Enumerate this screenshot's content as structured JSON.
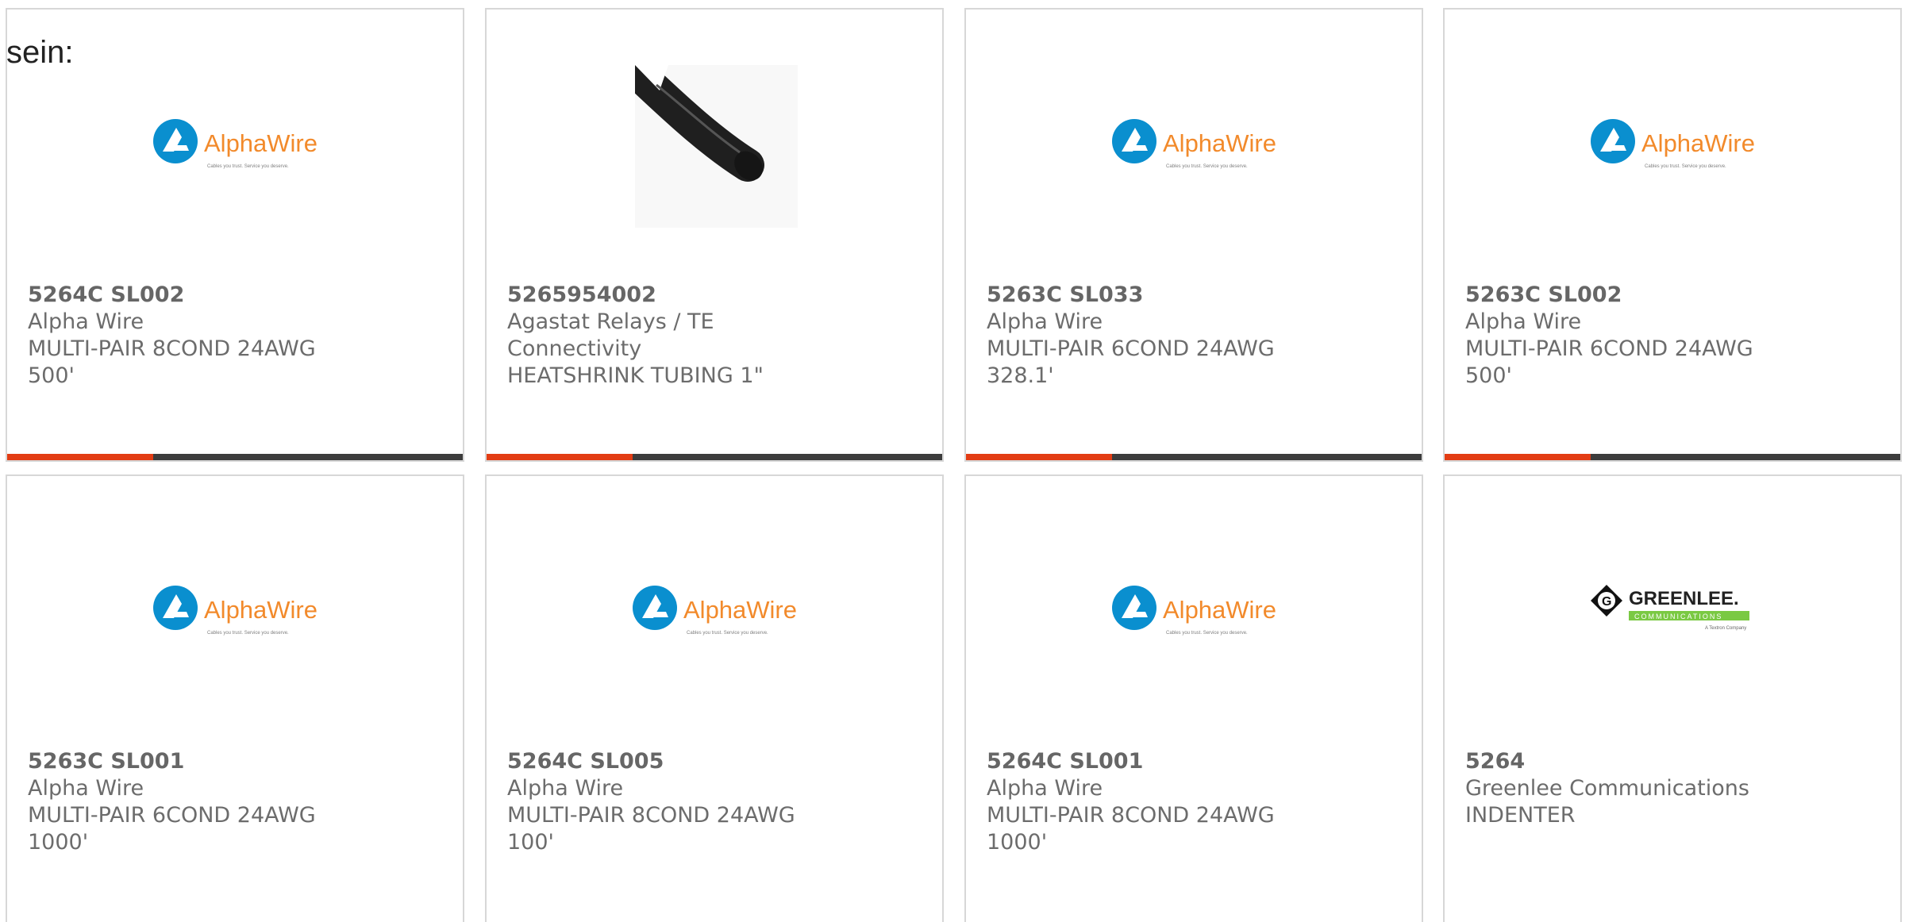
{
  "intro": {
    "text": "sein:"
  },
  "logos": {
    "alphawire": {
      "name": "AlphaWire",
      "tagline": "Cables you trust. Service you deserve."
    },
    "greenlee": {
      "brand": "GREENLEE.",
      "sub": "COMMUNICATIONS",
      "tagline": "A Textron Company"
    }
  },
  "colors": {
    "alpha_blue": "#0a8fcf",
    "alpha_orange": "#f28a2b",
    "greenlee_green": "#7ac943",
    "accent_red": "#e33d14",
    "progress_dark": "#3d3d3d"
  },
  "cards": [
    {
      "part_number": "5264C SL002",
      "manufacturer": "Alpha Wire",
      "description": "MULTI-PAIR 8COND 24AWG 500'",
      "image": "alphawire-logo",
      "progress_fraction": 0.32
    },
    {
      "part_number": "5265954002",
      "manufacturer": "Agastat Relays / TE Connectivity",
      "description": "HEATSHRINK TUBING 1\"",
      "image": "black-heatshrink-tubing-image",
      "progress_fraction": 0.32
    },
    {
      "part_number": "5263C SL033",
      "manufacturer": "Alpha Wire",
      "description": "MULTI-PAIR 6COND 24AWG 328.1'",
      "image": "alphawire-logo",
      "progress_fraction": 0.32
    },
    {
      "part_number": "5263C SL002",
      "manufacturer": "Alpha Wire",
      "description": "MULTI-PAIR 6COND 24AWG 500'",
      "image": "alphawire-logo",
      "progress_fraction": 0.32
    },
    {
      "part_number": "5263C SL001",
      "manufacturer": "Alpha Wire",
      "description": "MULTI-PAIR 6COND 24AWG 1000'",
      "image": "alphawire-logo"
    },
    {
      "part_number": "5264C SL005",
      "manufacturer": "Alpha Wire",
      "description": "MULTI-PAIR 8COND 24AWG 100'",
      "image": "alphawire-logo"
    },
    {
      "part_number": "5264C SL001",
      "manufacturer": "Alpha Wire",
      "description": "MULTI-PAIR 8COND 24AWG 1000'",
      "image": "alphawire-logo"
    },
    {
      "part_number": "5264",
      "manufacturer": "Greenlee Communications",
      "description": "INDENTER",
      "image": "greenlee-logo"
    }
  ]
}
